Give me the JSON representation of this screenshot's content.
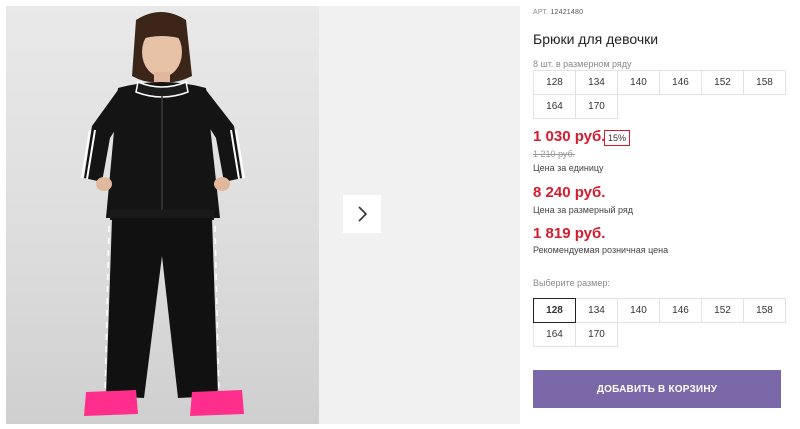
{
  "gallery": {
    "next_icon": "chevron-right-icon"
  },
  "product": {
    "art_label": "АРТ.",
    "art_number": "12421480",
    "title": "Брюки для девочки",
    "pack_label": "8 шт. в размерном ряду",
    "pack_sizes": [
      "128",
      "134",
      "140",
      "146",
      "152",
      "158",
      "164",
      "170"
    ],
    "price": "1 030 руб.",
    "discount": "15%",
    "old_price": "1 210 руб.",
    "unit_label": "Цена за единицу",
    "pack_price": "8 240 руб.",
    "pack_price_label": "Цена за размерный ряд",
    "rrp": "1 819 руб.",
    "rrp_label": "Рекомендуемая розничная цена",
    "choose_label": "Выберите размер:",
    "choose_sizes": [
      "128",
      "134",
      "140",
      "146",
      "152",
      "158",
      "164",
      "170"
    ],
    "selected_size": "128",
    "cart_button": "ДОБАВИТЬ В КОРЗИНУ"
  },
  "colors": {
    "price_red": "#d51c2e",
    "cart_purple": "#7a68a8"
  }
}
